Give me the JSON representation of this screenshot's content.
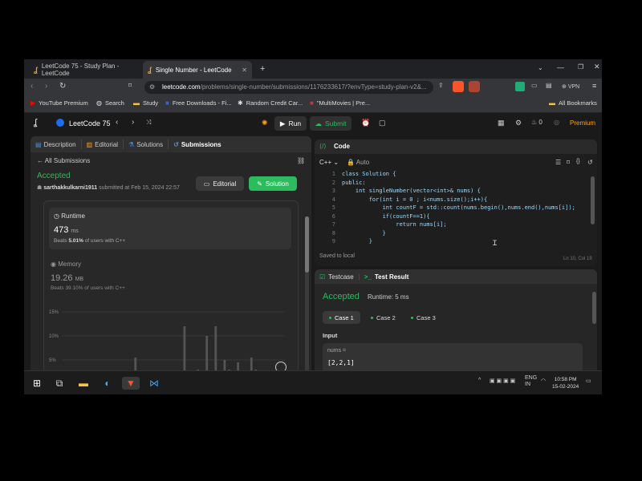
{
  "browser": {
    "tabs": [
      {
        "label": "LeetCode 75 - Study Plan - LeetCode",
        "active": false
      },
      {
        "label": "Single Number - LeetCode",
        "active": true
      }
    ],
    "url_host": "leetcode.com",
    "url_path": "/problems/single-number/submissions/1176233617/?envType=study-plan-v2&...",
    "vpn_label": "VPN",
    "bookmarks": [
      {
        "label": "YouTube Premium",
        "icon": "youtube-icon"
      },
      {
        "label": "Search",
        "icon": "globe-icon"
      },
      {
        "label": "Study",
        "icon": "folder-icon"
      },
      {
        "label": "Free Downloads - Fi...",
        "icon": "site-icon"
      },
      {
        "label": "Random Credit Car...",
        "icon": "gear-icon"
      },
      {
        "label": "\"MultiMovies | Pre...",
        "icon": "site-icon"
      }
    ],
    "all_bookmarks": "All Bookmarks"
  },
  "header": {
    "title": "LeetCode 75",
    "run": "Run",
    "submit": "Submit",
    "fire_count": "0",
    "premium": "Premium"
  },
  "left": {
    "tabs": [
      "Description",
      "Editorial",
      "Solutions",
      "Submissions"
    ],
    "back": "All Submissions",
    "status": "Accepted",
    "user": "sarthakkulkarni1911",
    "submitted": "submitted at Feb 15, 2024 22:57",
    "editorial_btn": "Editorial",
    "solution_btn": "Solution",
    "runtime": {
      "label": "Runtime",
      "value": "473",
      "unit": "ms",
      "beats_prefix": "Beats",
      "beats": "5.01%",
      "beats_suffix": "of users with C++"
    },
    "memory": {
      "label": "Memory",
      "value": "19.26",
      "unit": "MB",
      "beats_prefix": "Beats",
      "beats": "39.10%",
      "beats_suffix": "of users with C++"
    },
    "y_ticks": [
      "15%",
      "10%",
      "5%"
    ]
  },
  "chart_data": {
    "type": "bar",
    "ylim": [
      0,
      17
    ],
    "y_ticks": [
      "15%",
      "10%",
      "5%"
    ],
    "values": [
      0,
      0,
      0,
      0,
      0,
      0,
      0,
      0,
      0,
      0,
      0,
      0,
      0,
      0,
      0,
      0,
      5.5,
      0,
      0,
      0,
      0,
      0,
      0,
      0,
      0,
      0,
      0,
      12,
      0,
      0,
      3,
      0,
      10,
      0,
      12,
      0,
      5,
      3,
      0,
      4.5,
      1.5,
      0,
      5.5,
      3,
      0,
      0,
      0,
      0,
      0,
      0
    ]
  },
  "code": {
    "title": "Code",
    "lang": "C++",
    "auto": "Auto",
    "lines": [
      "class Solution {",
      "public:",
      "    int singleNumber(vector<int>& nums) {",
      "        for(int i = 0 ; i<nums.size();i++){",
      "            int countF = std::count(nums.begin(),nums.end(),nums[i]);",
      "            if(countF==1){",
      "                return nums[i];",
      "            }",
      "        }"
    ],
    "saved": "Saved to local",
    "position": "Ln 10, Col 19"
  },
  "test": {
    "tab1": "Testcase",
    "tab2": "Test Result",
    "status": "Accepted",
    "runtime": "Runtime: 5 ms",
    "cases": [
      "Case 1",
      "Case 2",
      "Case 3"
    ],
    "input_label": "Input",
    "var_name": "nums =",
    "var_value": "[2,2,1]"
  },
  "taskbar": {
    "lang": "ENG",
    "region": "IN",
    "time": "10:58 PM",
    "date": "15-02-2024"
  }
}
